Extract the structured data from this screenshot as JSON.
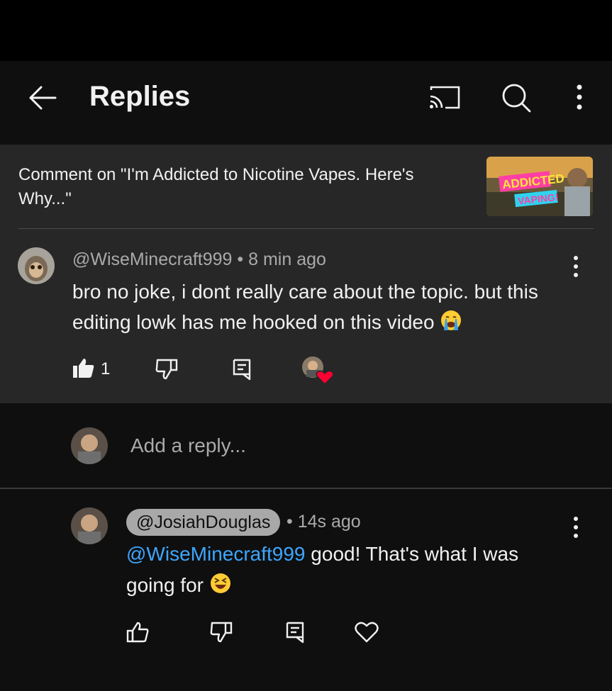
{
  "header": {
    "title": "Replies",
    "back_icon": "arrow-left-icon",
    "cast_icon": "cast-icon",
    "search_icon": "search-icon",
    "more_icon": "more-vertical-icon"
  },
  "context": {
    "text": "Comment on \"I'm Addicted to Nicotine Vapes. Here's Why...\"",
    "thumbnail_text_1": "ADDICTED",
    "thumbnail_text_2": "VAPING!"
  },
  "parent_comment": {
    "author": "@WiseMinecraft999",
    "separator": "•",
    "time": "8 min ago",
    "text": "bro no joke, i dont really care about the topic. but this editing lowk has me hooked on this video",
    "emoji": "loudly-crying-face",
    "like_count": "1"
  },
  "reply_input": {
    "placeholder": "Add a reply..."
  },
  "reply": {
    "author": "@JosiahDouglas",
    "separator": "•",
    "time": "14s ago",
    "mention": "@WiseMinecraft999",
    "text_part1": "good! That's what I was",
    "text_part2": "going for",
    "emoji": "grinning-squinting-face"
  },
  "colors": {
    "background": "#0f0f0f",
    "highlight_bg": "#272727",
    "mention": "#3ea6ff",
    "secondary_text": "#aaaaaa",
    "heart": "#ff0033"
  }
}
